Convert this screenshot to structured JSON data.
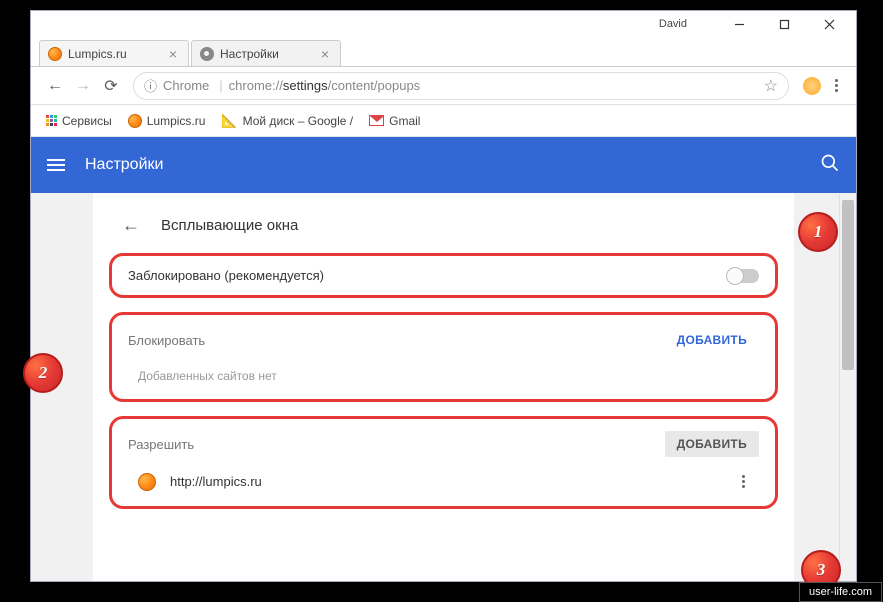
{
  "window": {
    "user": "David"
  },
  "tabs": [
    {
      "title": "Lumpics.ru"
    },
    {
      "title": "Настройки"
    }
  ],
  "address": {
    "secure_label": "Chrome",
    "url_host": "chrome://",
    "url_path1": "settings",
    "url_path2": "/content/popups"
  },
  "bookmarks": {
    "apps": "Сервисы",
    "items": [
      {
        "label": "Lumpics.ru"
      },
      {
        "label": "Мой диск – Google /"
      },
      {
        "label": "Gmail"
      }
    ]
  },
  "bluebar": {
    "title": "Настройки"
  },
  "page": {
    "title": "Всплывающие окна",
    "blocked_label": "Заблокировано (рекомендуется)",
    "block_section": "Блокировать",
    "add_label": "ДОБАВИТЬ",
    "empty_text": "Добавленных сайтов нет",
    "allow_section": "Разрешить",
    "allowed_site": "http://lumpics.ru"
  },
  "callouts": {
    "c1": "1",
    "c2": "2",
    "c3": "3"
  },
  "watermark": "user-life.com"
}
